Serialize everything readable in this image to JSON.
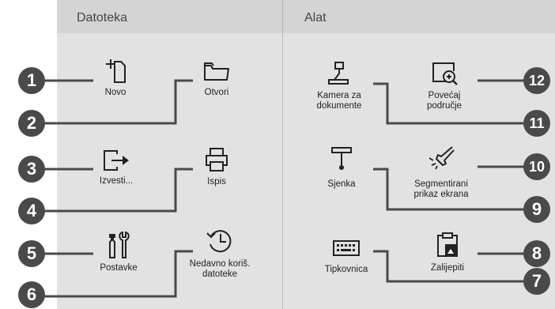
{
  "headers": {
    "left": "Datoteka",
    "right": "Alat"
  },
  "items": {
    "new": "Novo",
    "open": "Otvori",
    "export": "Izvesti...",
    "print": "Ispis",
    "settings": "Postavke",
    "recent_line1": "Nedavno koriš.",
    "recent_line2": "datoteke",
    "doc_camera_line1": "Kamera za",
    "doc_camera_line2": "dokumente",
    "zoom_line1": "Povećaj",
    "zoom_line2": "područje",
    "shade": "Sjenka",
    "spotlight_line1": "Segmentirani",
    "spotlight_line2": "prikaz ekrana",
    "keyboard": "Tipkovnica",
    "paste": "Zalijepiti"
  },
  "callouts": [
    "1",
    "2",
    "3",
    "4",
    "5",
    "6",
    "7",
    "8",
    "9",
    "10",
    "11",
    "12"
  ],
  "icons": {
    "new": "new-file-icon",
    "open": "folder-icon",
    "export": "export-arrow-icon",
    "print": "printer-icon",
    "settings": "tools-icon",
    "recent": "history-clock-icon",
    "doc_camera": "document-camera-icon",
    "zoom": "zoom-area-icon",
    "shade": "shade-icon",
    "spotlight": "spotlight-icon",
    "keyboard": "keyboard-icon",
    "paste": "paste-icon"
  },
  "colors": {
    "panel": "#e2e2e2",
    "header": "#d4d4d4",
    "callout": "#4a4a4a"
  }
}
